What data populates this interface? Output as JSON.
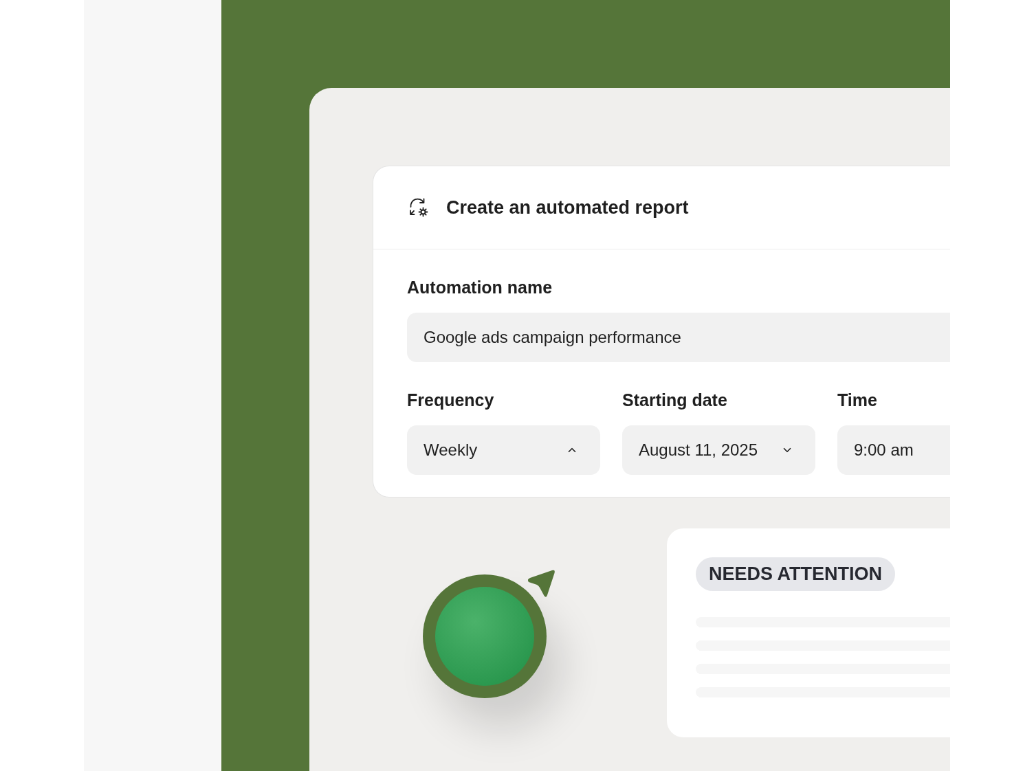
{
  "header": {
    "title": "Create an automated report"
  },
  "form": {
    "name_field": {
      "label": "Automation name",
      "value": "Google ads campaign performance"
    },
    "selects": [
      {
        "label": "Frequency",
        "value": "Weekly",
        "expanded": true
      },
      {
        "label": "Starting date",
        "value": "August 11, 2025",
        "expanded": false
      },
      {
        "label": "Time",
        "value": "9:00 am"
      }
    ]
  },
  "status_card": {
    "badge": "NEEDS ATTENTION"
  }
}
